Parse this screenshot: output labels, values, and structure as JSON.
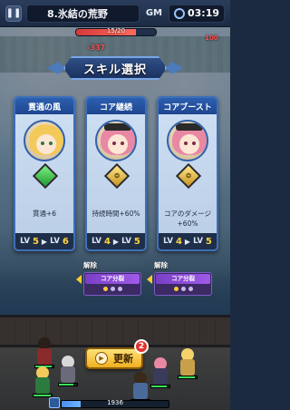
{
  "topbar": {
    "pause_icon": "pause-icon",
    "stage_title": "8.氷結の荒野",
    "gm_label": "GM",
    "timer": "03:19"
  },
  "wave": {
    "text": "15/20",
    "progress": 0.75,
    "left_value": "-337",
    "right_value": "100"
  },
  "dialog": {
    "title": "スキル選択"
  },
  "cards": [
    {
      "title": "貫通の風",
      "desc": "貫通+6",
      "lv_prefix": "LV",
      "lv_from": "5",
      "lv_arrow": "▶",
      "lv_to_prefix": "LV",
      "lv_to": "6",
      "gem": "green"
    },
    {
      "title": "コア継続",
      "desc": "持続時間+60%",
      "lv_prefix": "LV",
      "lv_from": "4",
      "lv_arrow": "▶",
      "lv_to_prefix": "LV",
      "lv_to": "5",
      "gem": "gold"
    },
    {
      "title": "コアブースト",
      "desc": "コアのダメージ+60%",
      "lv_prefix": "LV",
      "lv_from": "4",
      "lv_arrow": "▶",
      "lv_to_prefix": "LV",
      "lv_to": "5",
      "gem": "gold"
    }
  ],
  "unlocks": [
    {
      "label": "解除",
      "tag": "コア分裂",
      "filled": 1,
      "total": 3
    },
    {
      "label": "解除",
      "tag": "コア分裂",
      "filled": 1,
      "total": 3
    }
  ],
  "refresh": {
    "label": "更新",
    "badge": "2"
  },
  "exp": {
    "text": "1936"
  },
  "colors": {
    "accent": "#2c5fb0",
    "level_number": "#ffd43a",
    "refresh_button": "#f0b020",
    "badge": "#e0332c",
    "unlock_tag": "#a05ae8"
  }
}
